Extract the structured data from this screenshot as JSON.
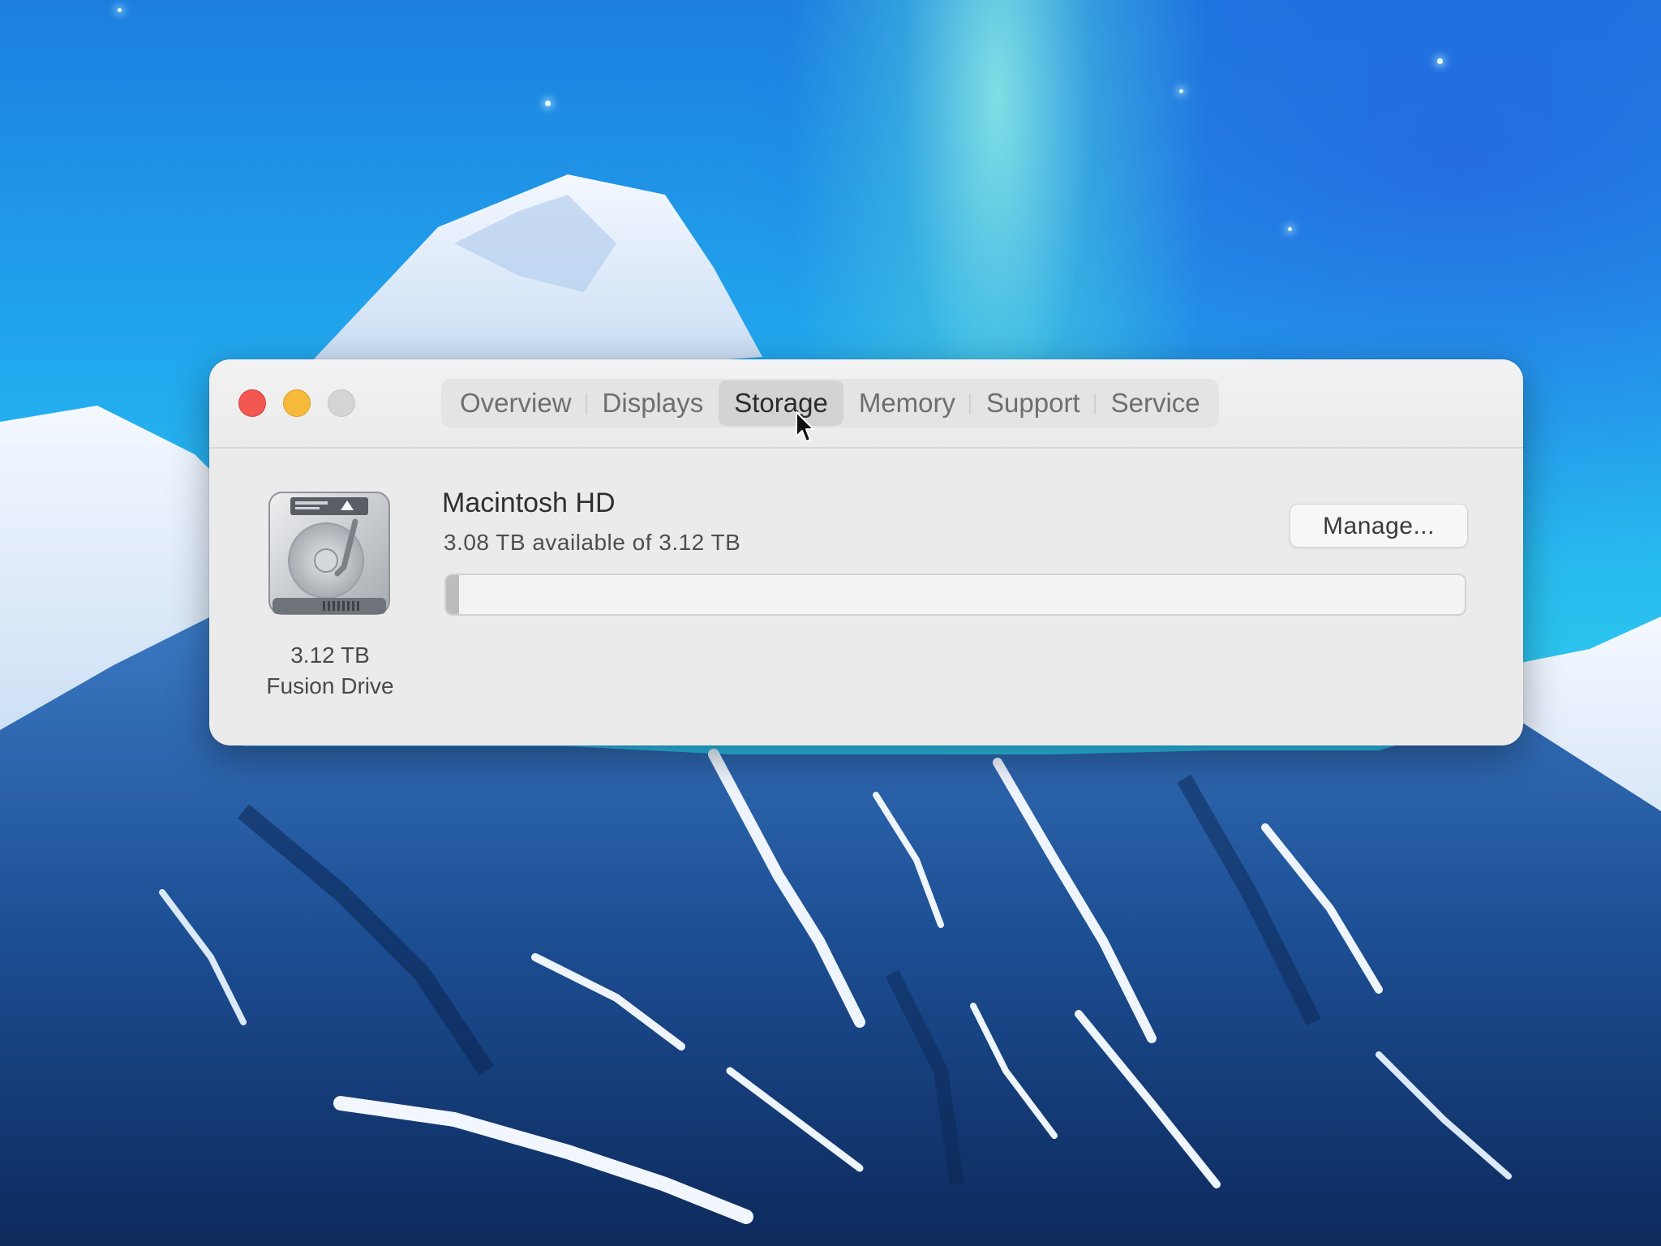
{
  "window": {
    "controls": {
      "close": "close-button",
      "minimize": "minimize-button",
      "zoom": "zoom-button"
    },
    "tabs": [
      {
        "label": "Overview",
        "active": false
      },
      {
        "label": "Displays",
        "active": false
      },
      {
        "label": "Storage",
        "active": true
      },
      {
        "label": "Memory",
        "active": false
      },
      {
        "label": "Support",
        "active": false
      },
      {
        "label": "Service",
        "active": false
      }
    ]
  },
  "drive": {
    "icon": "hard-drive-icon",
    "size": "3.12 TB",
    "type": "Fusion Drive"
  },
  "volume": {
    "name": "Macintosh HD",
    "available": "3.08 TB available of 3.12 TB",
    "used_fraction": 0.013,
    "manage_label": "Manage..."
  },
  "colors": {
    "close": "#f25751",
    "minimize": "#f6b93a",
    "zoom": "#d4d4d4",
    "window_bg": "#ebebeb",
    "active_tab": "#d3d3d3"
  }
}
